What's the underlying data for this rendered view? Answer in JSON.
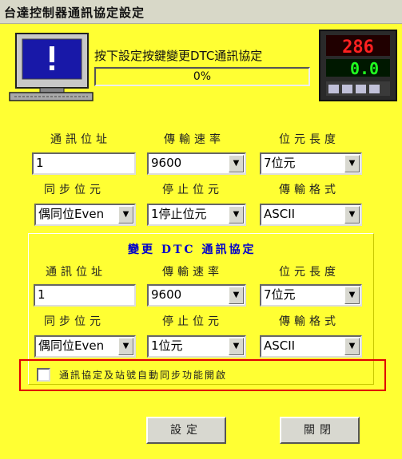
{
  "window": {
    "title": "台達控制器通訊協定設定"
  },
  "header": {
    "message": "按下設定按鍵變更DTC通訊協定",
    "progress_percent": 0,
    "progress_label": "0%",
    "controller_display": {
      "pv": "286",
      "sv": "0.0"
    }
  },
  "current": {
    "address_label": "通訊位址",
    "address_value": "1",
    "baud_label": "傳輸速率",
    "baud_value": "9600",
    "bits_label": "位元長度",
    "bits_value": "7位元",
    "parity_label": "同步位元",
    "parity_value": "偶同位Even",
    "stop_label": "停止位元",
    "stop_value": "1停止位元",
    "format_label": "傳輸格式",
    "format_value": "ASCII"
  },
  "change": {
    "title": "變更 DTC 通訊協定",
    "address_label": "通訊位址",
    "address_value": "1",
    "baud_label": "傳輸速率",
    "baud_value": "9600",
    "bits_label": "位元長度",
    "bits_value": "7位元",
    "parity_label": "同步位元",
    "parity_value": "偶同位Even",
    "stop_label": "停止位元",
    "stop_value": "1位元",
    "format_label": "傳輸格式",
    "format_value": "ASCII"
  },
  "auto_sync": {
    "label": "通訊協定及站號自動同步功能開啟",
    "checked": false
  },
  "buttons": {
    "set": "設定",
    "close": "關閉"
  },
  "colors": {
    "background": "#ffff33",
    "highlight": "#e00000",
    "title_text": "#0000cc"
  },
  "icons": {
    "arrow": "▼"
  }
}
